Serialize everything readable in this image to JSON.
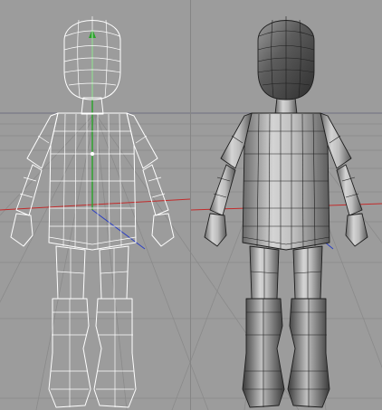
{
  "viewport": {
    "view_mode_left": "wireframe",
    "view_mode_right": "shaded",
    "background_color": "#9c9c9c",
    "grid_color": "#8a8a8a",
    "grid_horizon_color": "#6b6b7a",
    "wire_color": "#ffffff",
    "shaded_color": "#c8c8c8",
    "shaded_dark_color": "#4a4a4a",
    "shaded_edge_color": "#1e1e1e",
    "axis_colors": {
      "x": "#c22b2b",
      "y": "#29a329",
      "z": "#2b3fc2"
    }
  },
  "model": {
    "name": ""
  }
}
